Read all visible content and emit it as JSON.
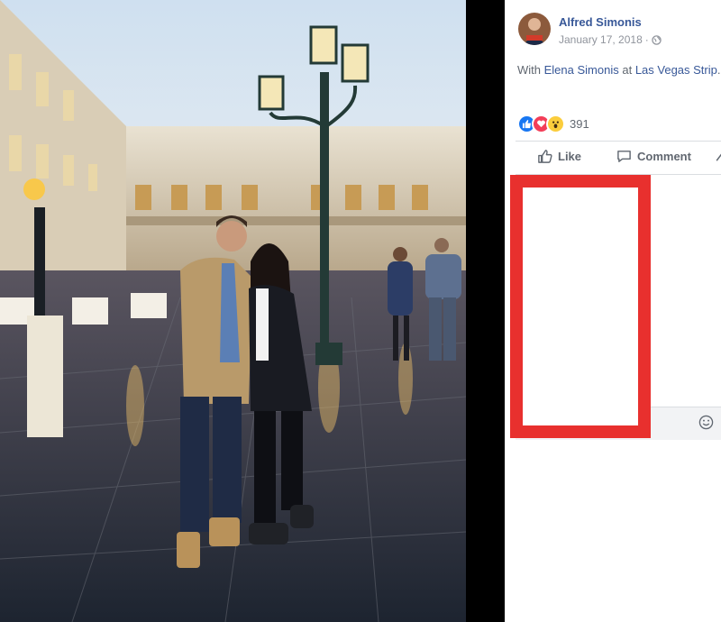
{
  "post": {
    "author": "Alfred Simonis",
    "date": "January 17, 2018",
    "date_separator": "·",
    "privacy_icon": "globe-icon",
    "caption": {
      "prefix": "With ",
      "tagged_person": "Elena Simonis",
      "middle": " at ",
      "location": "Las Vegas Strip",
      "suffix": "."
    }
  },
  "reactions": {
    "icons": [
      "like-reaction-icon",
      "love-reaction-icon",
      "wow-reaction-icon"
    ],
    "count": "391"
  },
  "actions": {
    "like_label": "Like",
    "comment_label": "Comment"
  },
  "colors": {
    "link": "#385898",
    "like_blue": "#1877f2",
    "love_red": "#f33e58",
    "wow_yellow": "#fbcd3c",
    "redaction_red": "#e8302e"
  }
}
